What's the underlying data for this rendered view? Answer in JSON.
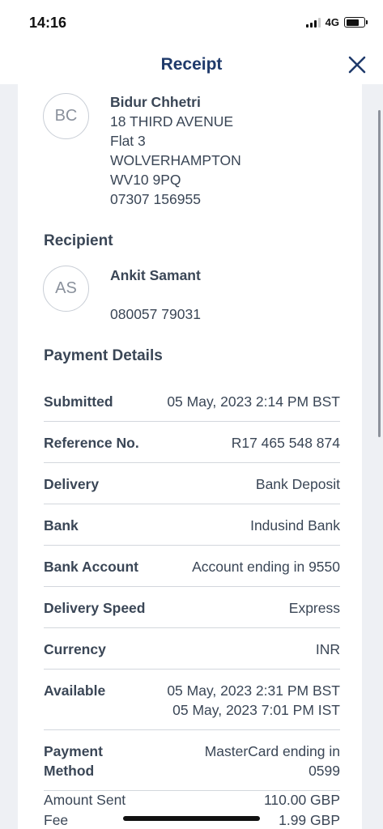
{
  "status_bar": {
    "time": "14:16",
    "network": "4G",
    "signal_bars_active": 3,
    "battery_level": 0.75
  },
  "header": {
    "title": "Receipt",
    "close_icon": "close-icon"
  },
  "sender": {
    "initials": "BC",
    "name": "Bidur Chhetri",
    "address_line1": "18 THIRD AVENUE",
    "address_line2": "Flat 3",
    "city": "WOLVERHAMPTON",
    "postcode": "WV10 9PQ",
    "phone": "07307 156955"
  },
  "recipient": {
    "section_title": "Recipient",
    "initials": "AS",
    "name": "Ankit Samant",
    "phone": "080057 79031"
  },
  "payment_details": {
    "section_title": "Payment Details",
    "rows": [
      {
        "label": "Submitted",
        "value": "05 May, 2023 2:14 PM BST"
      },
      {
        "label": "Reference No.",
        "value": "R17 465 548 874"
      },
      {
        "label": "Delivery",
        "value": "Bank Deposit"
      },
      {
        "label": "Bank",
        "value": "Indusind Bank"
      },
      {
        "label": "Bank Account",
        "value": "Account ending in 9550"
      },
      {
        "label": "Delivery Speed",
        "value": "Express"
      },
      {
        "label": "Currency",
        "value": "INR"
      }
    ],
    "available": {
      "label": "Available",
      "value_line1": "05 May, 2023 2:31 PM BST",
      "value_line2": "05 May, 2023 7:01 PM IST"
    },
    "payment_method": {
      "label_line1": "Payment",
      "label_line2": "Method",
      "value_line1": "MasterCard ending in",
      "value_line2": "0599"
    }
  },
  "amounts": {
    "sent_label": "Amount Sent",
    "sent_value": "110.00 GBP",
    "fee_label": "Fee",
    "fee_value": "1.99 GBP"
  },
  "colors": {
    "title": "#1f3a6b",
    "text": "#3a4656",
    "background": "#eef0f4",
    "card": "#ffffff"
  }
}
